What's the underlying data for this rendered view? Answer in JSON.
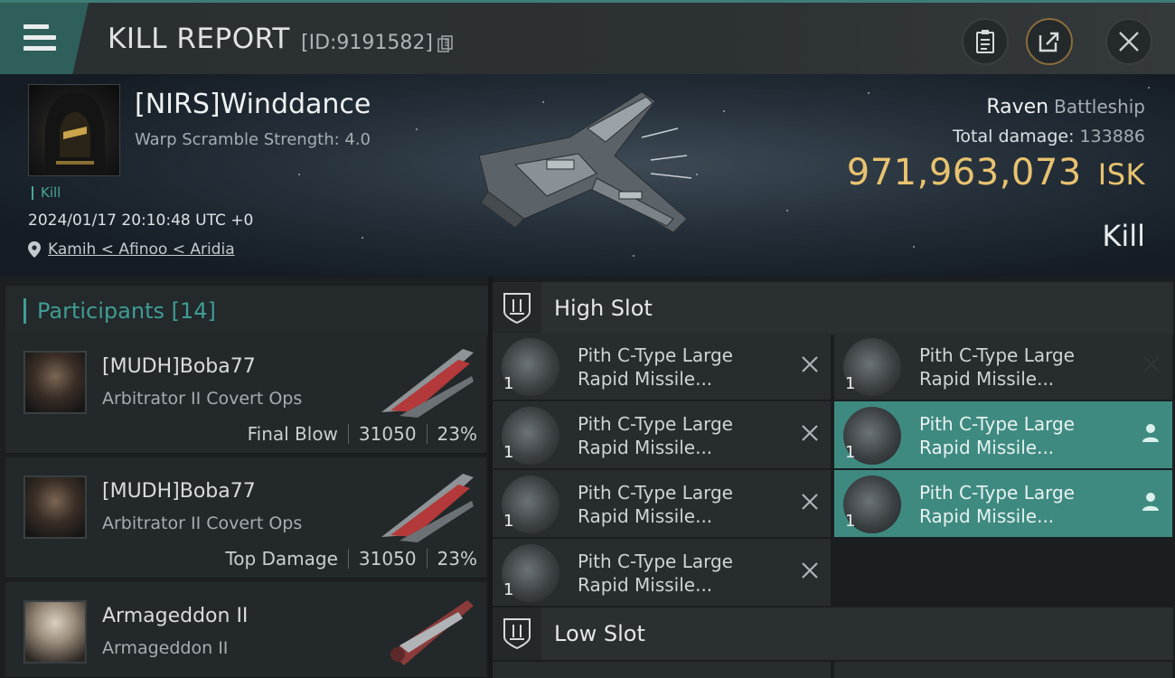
{
  "header": {
    "title": "KILL REPORT",
    "report_id": "[ID:9191582]",
    "icons": [
      "menu-icon",
      "copy-icon",
      "clipboard-icon",
      "share-icon",
      "close-icon"
    ]
  },
  "victim": {
    "name": "[NIRS]Winddance",
    "warp_scramble": "Warp Scramble Strength: 4.0",
    "kill_tag": "Kill",
    "datetime": "2024/01/17 20:10:48 UTC +0",
    "location": "Kamih < Afinoo < Aridia",
    "ship_name": "Raven",
    "ship_class": "Battleship",
    "total_damage_label": "Total damage:",
    "total_damage_value": "133886",
    "isk_value": "971,963,073",
    "isk_unit": "ISK",
    "result": "Kill"
  },
  "participants": {
    "header_label": "Participants",
    "count": "[14]",
    "rows": [
      {
        "name": "[MUDH]Boba77",
        "ship": "Arbitrator II Covert Ops",
        "tag": "Final Blow",
        "damage": "31050",
        "percent": "23%"
      },
      {
        "name": "[MUDH]Boba77",
        "ship": "Arbitrator II Covert Ops",
        "tag": "Top Damage",
        "damage": "31050",
        "percent": "23%"
      },
      {
        "name": "Armageddon II",
        "ship": "Armageddon II",
        "tag": "",
        "damage": "",
        "percent": ""
      }
    ]
  },
  "slots": {
    "high_slot_label": "High Slot",
    "low_slot_label": "Low Slot",
    "high_modules": [
      {
        "line1": "Pith C-Type Large",
        "line2": "Rapid Missile...",
        "qty": "1",
        "state": "destroyed"
      },
      {
        "line1": "Pith C-Type Large",
        "line2": "Rapid Missile...",
        "qty": "1",
        "state": "destroyed"
      },
      {
        "line1": "Pith C-Type Large",
        "line2": "Rapid Missile...",
        "qty": "1",
        "state": "destroyed"
      },
      {
        "line1": "Pith C-Type Large",
        "line2": "Rapid Missile...",
        "qty": "1",
        "state": "dropped"
      },
      {
        "line1": "Pith C-Type Large",
        "line2": "Rapid Missile...",
        "qty": "1",
        "state": "destroyed"
      },
      {
        "line1": "Pith C-Type Large",
        "line2": "Rapid Missile...",
        "qty": "1",
        "state": "dropped"
      },
      {
        "line1": "Pith C-Type Large",
        "line2": "Rapid Missile...",
        "qty": "1",
        "state": "destroyed"
      }
    ]
  },
  "colors": {
    "accent_teal": "#3f9d93",
    "isk_gold": "#e8c270",
    "dropped_highlight": "#3e8a80"
  }
}
